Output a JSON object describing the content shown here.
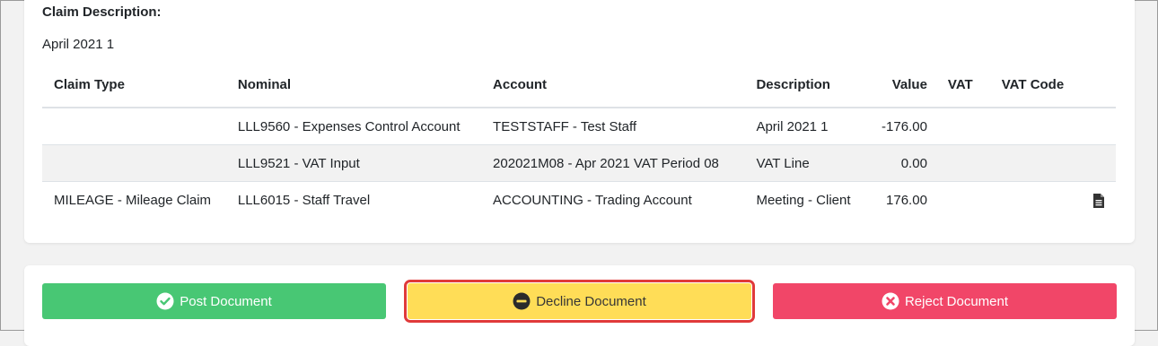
{
  "claim": {
    "label": "Claim Description:",
    "value": "April 2021 1"
  },
  "table": {
    "headers": [
      "Claim Type",
      "Nominal",
      "Account",
      "Description",
      "Value",
      "VAT",
      "VAT Code"
    ],
    "rows": [
      {
        "claim_type": "",
        "nominal": "LLL9560 - Expenses Control Account",
        "account": "TESTSTAFF - Test Staff",
        "description": "April 2021 1",
        "value": "-176.00",
        "vat": "",
        "vat_code": ""
      },
      {
        "claim_type": "",
        "nominal": "LLL9521 - VAT Input",
        "account": "202021M08 - Apr 2021 VAT Period 08",
        "description": "VAT Line",
        "value": "0.00",
        "vat": "",
        "vat_code": ""
      },
      {
        "claim_type": "MILEAGE - Mileage Claim",
        "nominal": "LLL6015 - Staff Travel",
        "account": "ACCOUNTING - Trading Account",
        "description": "Meeting - Client",
        "value": "176.00",
        "vat": "",
        "vat_code": "",
        "icon": "document-icon"
      }
    ]
  },
  "actions": {
    "post_label": "Post Document",
    "decline_label": "Decline Document",
    "reject_label": "Reject Document"
  },
  "colors": {
    "post": "#48c774",
    "decline": "#ffdd57",
    "reject": "#f14668",
    "highlight": "#e03a3a"
  }
}
